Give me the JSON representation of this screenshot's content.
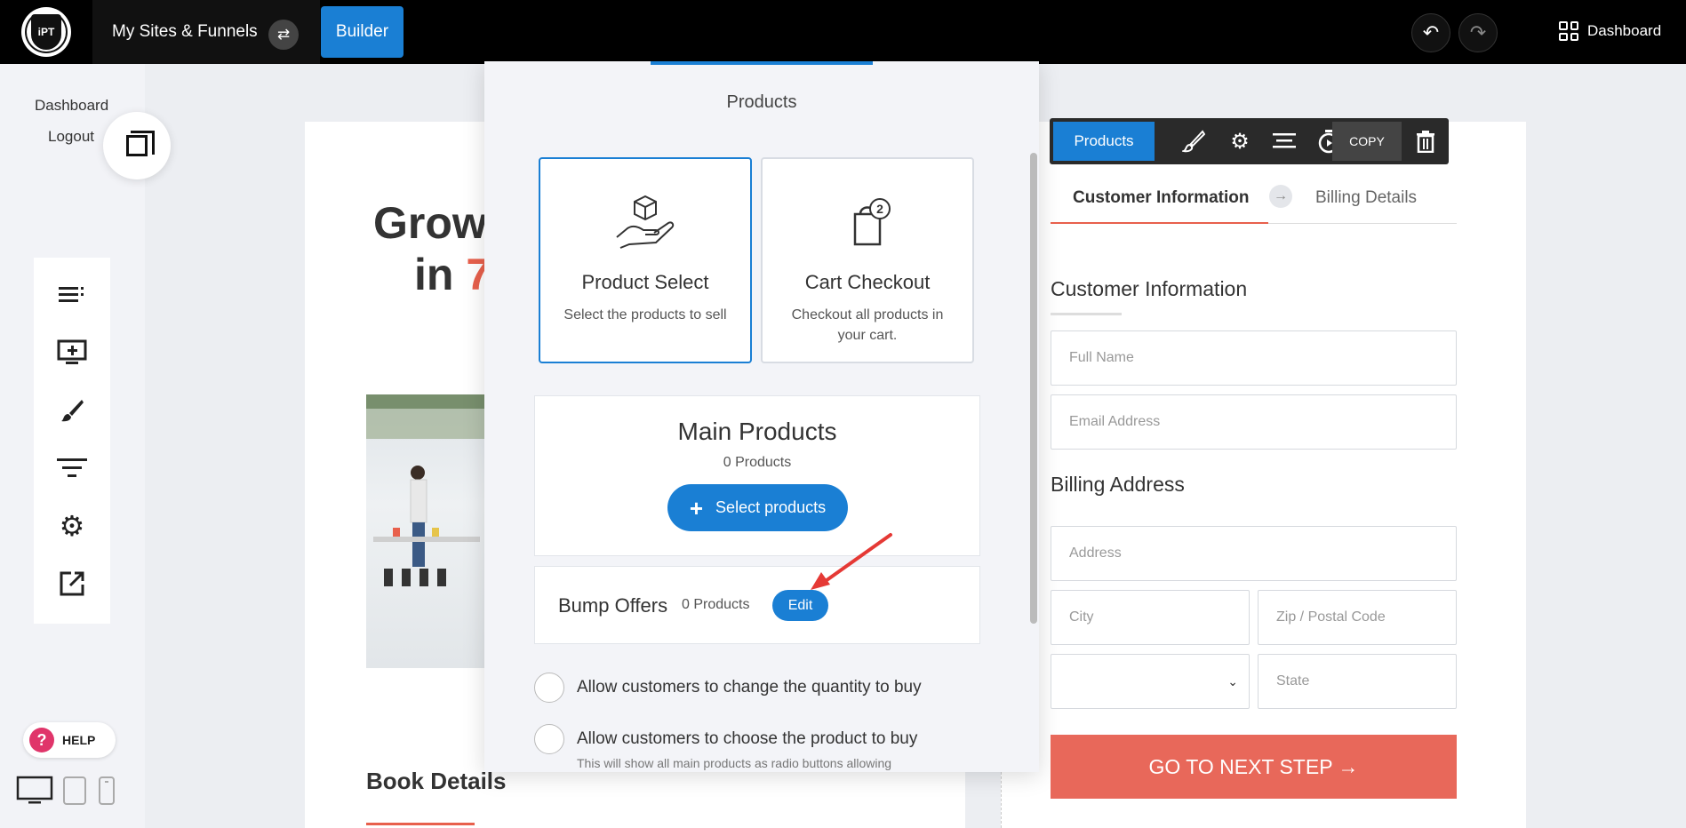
{
  "topbar": {
    "logo_text": "iPT",
    "title": "My Sites & Funnels",
    "builder_label": "Builder",
    "dashboard_label": "Dashboard"
  },
  "sidebar": {
    "dashboard_link": "Dashboard",
    "logout_link": "Logout",
    "help_label": "HELP"
  },
  "page": {
    "hero_line1": "Grow",
    "hero_line2_prefix": "in ",
    "hero_line2_accent": "7",
    "book_details": "Book Details"
  },
  "modal": {
    "title": "Products",
    "types": [
      {
        "name": "Product Select",
        "description": "Select the products to sell",
        "active": true
      },
      {
        "name": "Cart Checkout",
        "description": "Checkout all products in your cart.",
        "active": false,
        "badge": "2"
      }
    ],
    "main_products": {
      "title": "Main Products",
      "count": "0 Products",
      "button": "Select products",
      "button_icon": "+"
    },
    "bump_offers": {
      "title": "Bump Offers",
      "count": "0 Products",
      "edit": "Edit"
    },
    "options": [
      {
        "label": "Allow customers to change the quantity to buy"
      },
      {
        "label": "Allow customers to choose the product to buy",
        "sub": "This will show all main products as radio buttons allowing"
      }
    ]
  },
  "element_toolbar": {
    "products_label": "Products",
    "copy_label": "COPY"
  },
  "checkout": {
    "step_active": "Customer Information",
    "step_next": "Billing Details",
    "step_arrow": "→",
    "customer_title": "Customer Information",
    "full_name_ph": "Full Name",
    "email_ph": "Email Address",
    "billing_title": "Billing Address",
    "address_ph": "Address",
    "city_ph": "City",
    "zip_ph": "Zip / Postal Code",
    "country_caret": "⌄",
    "state_ph": "State",
    "next_button": "GO TO NEXT STEP →"
  },
  "colors": {
    "accent_blue": "#1a7fd4",
    "accent_orange": "#e8604c",
    "topbar": "#000000"
  }
}
